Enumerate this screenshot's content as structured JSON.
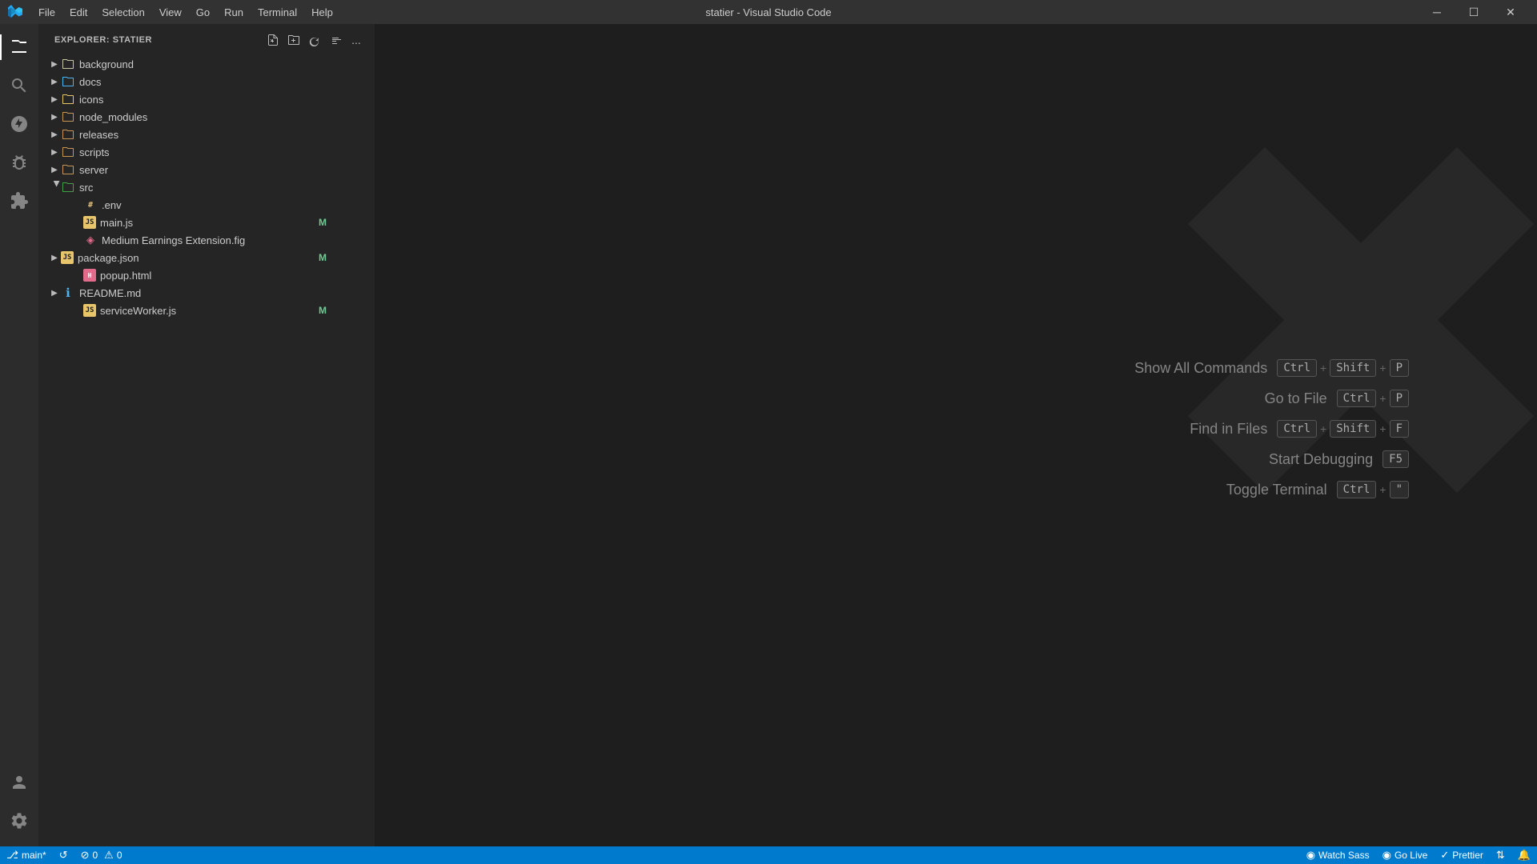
{
  "titlebar": {
    "title": "statier - Visual Studio Code",
    "menu": [
      "File",
      "Edit",
      "Selection",
      "View",
      "Go",
      "Run",
      "Terminal",
      "Help"
    ],
    "window_controls": [
      "─",
      "☐",
      "✕"
    ]
  },
  "sidebar": {
    "header": "EXPLORER: STATIER",
    "actions": [
      "💾",
      "📁",
      "↺",
      "⊟",
      "⋯"
    ]
  },
  "file_tree": [
    {
      "name": "background",
      "type": "folder",
      "icon_color": "default",
      "indent": 0
    },
    {
      "name": "docs",
      "type": "folder",
      "icon_color": "blue",
      "indent": 0
    },
    {
      "name": "icons",
      "type": "folder",
      "icon_color": "yellow",
      "indent": 0
    },
    {
      "name": "node_modules",
      "type": "folder",
      "icon_color": "brown",
      "indent": 0
    },
    {
      "name": "releases",
      "type": "folder",
      "icon_color": "brown",
      "indent": 0
    },
    {
      "name": "scripts",
      "type": "folder",
      "icon_color": "brown",
      "indent": 0
    },
    {
      "name": "server",
      "type": "folder",
      "icon_color": "brown",
      "indent": 0
    },
    {
      "name": "src",
      "type": "folder",
      "icon_color": "green",
      "indent": 0,
      "has_dot": true
    },
    {
      "name": ".env",
      "type": "file_env",
      "indent": 1
    },
    {
      "name": "main.js",
      "type": "file_js",
      "indent": 1,
      "badge": "M"
    },
    {
      "name": "Medium Earnings Extension.fig",
      "type": "file_fig",
      "indent": 1
    },
    {
      "name": "package.json",
      "type": "folder_json",
      "indent": 0,
      "badge": "M"
    },
    {
      "name": "popup.html",
      "type": "file_html",
      "indent": 1
    },
    {
      "name": "README.md",
      "type": "folder_md",
      "indent": 0
    },
    {
      "name": "serviceWorker.js",
      "type": "file_js",
      "indent": 1,
      "badge": "M"
    }
  ],
  "shortcuts": [
    {
      "label": "Show All Commands",
      "keys": [
        "Ctrl",
        "+",
        "Shift",
        "+",
        "P"
      ]
    },
    {
      "label": "Go to File",
      "keys": [
        "Ctrl",
        "+",
        "P"
      ]
    },
    {
      "label": "Find in Files",
      "keys": [
        "Ctrl",
        "+",
        "Shift",
        "+",
        "F"
      ]
    },
    {
      "label": "Start Debugging",
      "keys": [
        "F5"
      ]
    },
    {
      "label": "Toggle Terminal",
      "keys": [
        "Ctrl",
        "+",
        "\""
      ]
    }
  ],
  "statusbar": {
    "left": [
      {
        "icon": "⎇",
        "label": "main*"
      },
      {
        "icon": "↺",
        "label": ""
      },
      {
        "icon": "⊘",
        "label": "0"
      },
      {
        "icon": "⚠",
        "label": "0"
      }
    ],
    "right": [
      {
        "icon": "◉",
        "label": "Watch Sass"
      },
      {
        "icon": "◉",
        "label": "Go Live"
      },
      {
        "icon": "✓",
        "label": "Prettier"
      },
      {
        "icon": "⇅",
        "label": ""
      },
      {
        "icon": "🔔",
        "label": ""
      }
    ]
  }
}
